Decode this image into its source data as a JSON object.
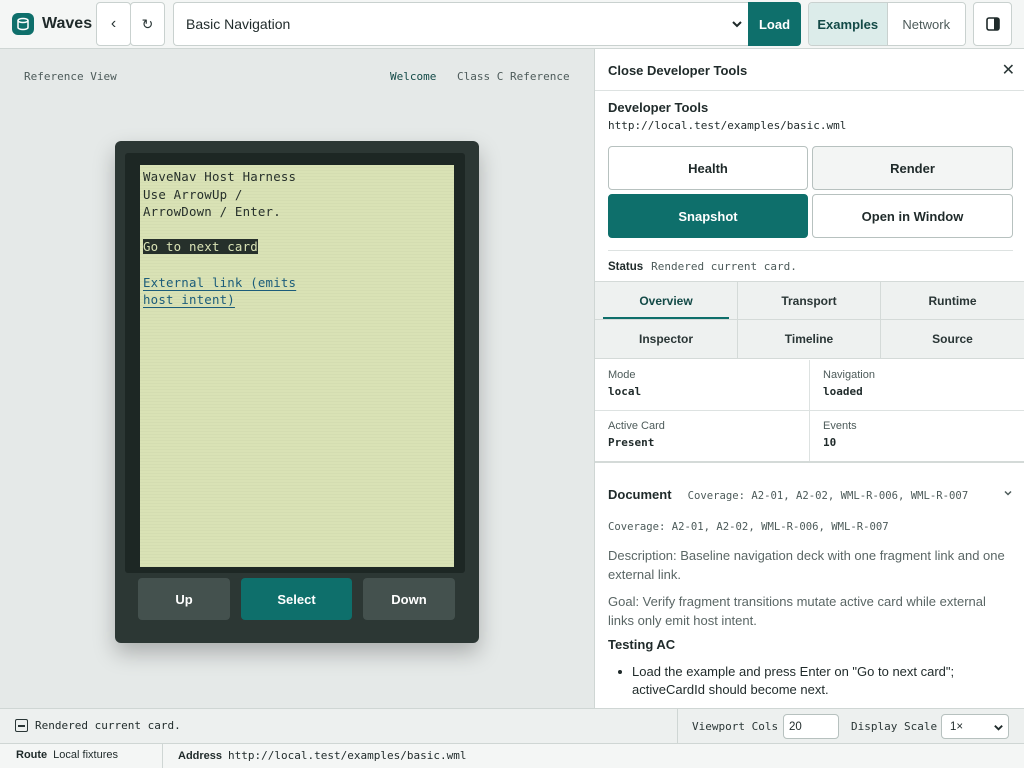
{
  "app": {
    "name": "Waves",
    "logo_icon": "waves-logo-icon",
    "accent": "#0e6f6b"
  },
  "toolbar": {
    "back_label": "‹",
    "reload_label": "↻",
    "deck_select_value": "Basic Navigation",
    "load_label": "Load",
    "mode_tabs": [
      {
        "label": "Examples",
        "active": true
      },
      {
        "label": "Network",
        "active": false
      }
    ]
  },
  "reference": {
    "label": "Reference View",
    "tabs": [
      {
        "label": "Welcome",
        "active": true
      },
      {
        "label": "Class C Reference",
        "active": false
      }
    ]
  },
  "device": {
    "screen_lines": [
      "WaveNav Host Harness",
      "Use ArrowUp /",
      "ArrowDown / Enter.",
      "",
      "Go to next card",
      "",
      "External link (emits",
      "host intent)"
    ],
    "buttons": {
      "up": "Up",
      "select": "Select",
      "down": "Down"
    }
  },
  "devtools": {
    "close_label": "Close Developer Tools",
    "title": "Developer Tools",
    "url": "http://local.test/examples/basic.wml",
    "actions": {
      "health": "Health",
      "render": "Render",
      "snapshot": "Snapshot",
      "open_window": "Open in Window"
    },
    "status": {
      "label": "Status",
      "value": "Rendered current card."
    },
    "tabs": [
      {
        "label": "Overview",
        "active": true
      },
      {
        "label": "Transport",
        "active": false
      },
      {
        "label": "Runtime",
        "active": false
      },
      {
        "label": "Inspector",
        "active": false
      },
      {
        "label": "Timeline",
        "active": false
      },
      {
        "label": "Source",
        "active": false
      }
    ],
    "info": [
      {
        "label": "Mode",
        "value": "local"
      },
      {
        "label": "Navigation",
        "value": "loaded"
      },
      {
        "label": "Active Card",
        "value": "Present"
      },
      {
        "label": "Events",
        "value": "10"
      }
    ],
    "document": {
      "title": "Document",
      "coverage_summary": "Coverage: A2-01, A2-02, WML-R-006, WML-R-007",
      "coverage": "Coverage: A2-01, A2-02, WML-R-006, WML-R-007",
      "description": "Description: Baseline navigation deck with one fragment link and one external link.",
      "goal": "Goal: Verify fragment transitions mutate active card while external links only emit host intent.",
      "testing_title": "Testing AC",
      "testing_items": [
        "Load the example and press Enter on \"Go to next card\"; activeCardId should become next."
      ]
    }
  },
  "statusbar": {
    "message": "Rendered current card.",
    "viewport_cols_label": "Viewport Cols",
    "viewport_cols_value": "20",
    "display_scale_label": "Display Scale",
    "display_scale_value": "1×"
  },
  "footer": {
    "route_label": "Route",
    "route_value": "Local fixtures",
    "address_label": "Address",
    "address_value": "http://local.test/examples/basic.wml"
  }
}
